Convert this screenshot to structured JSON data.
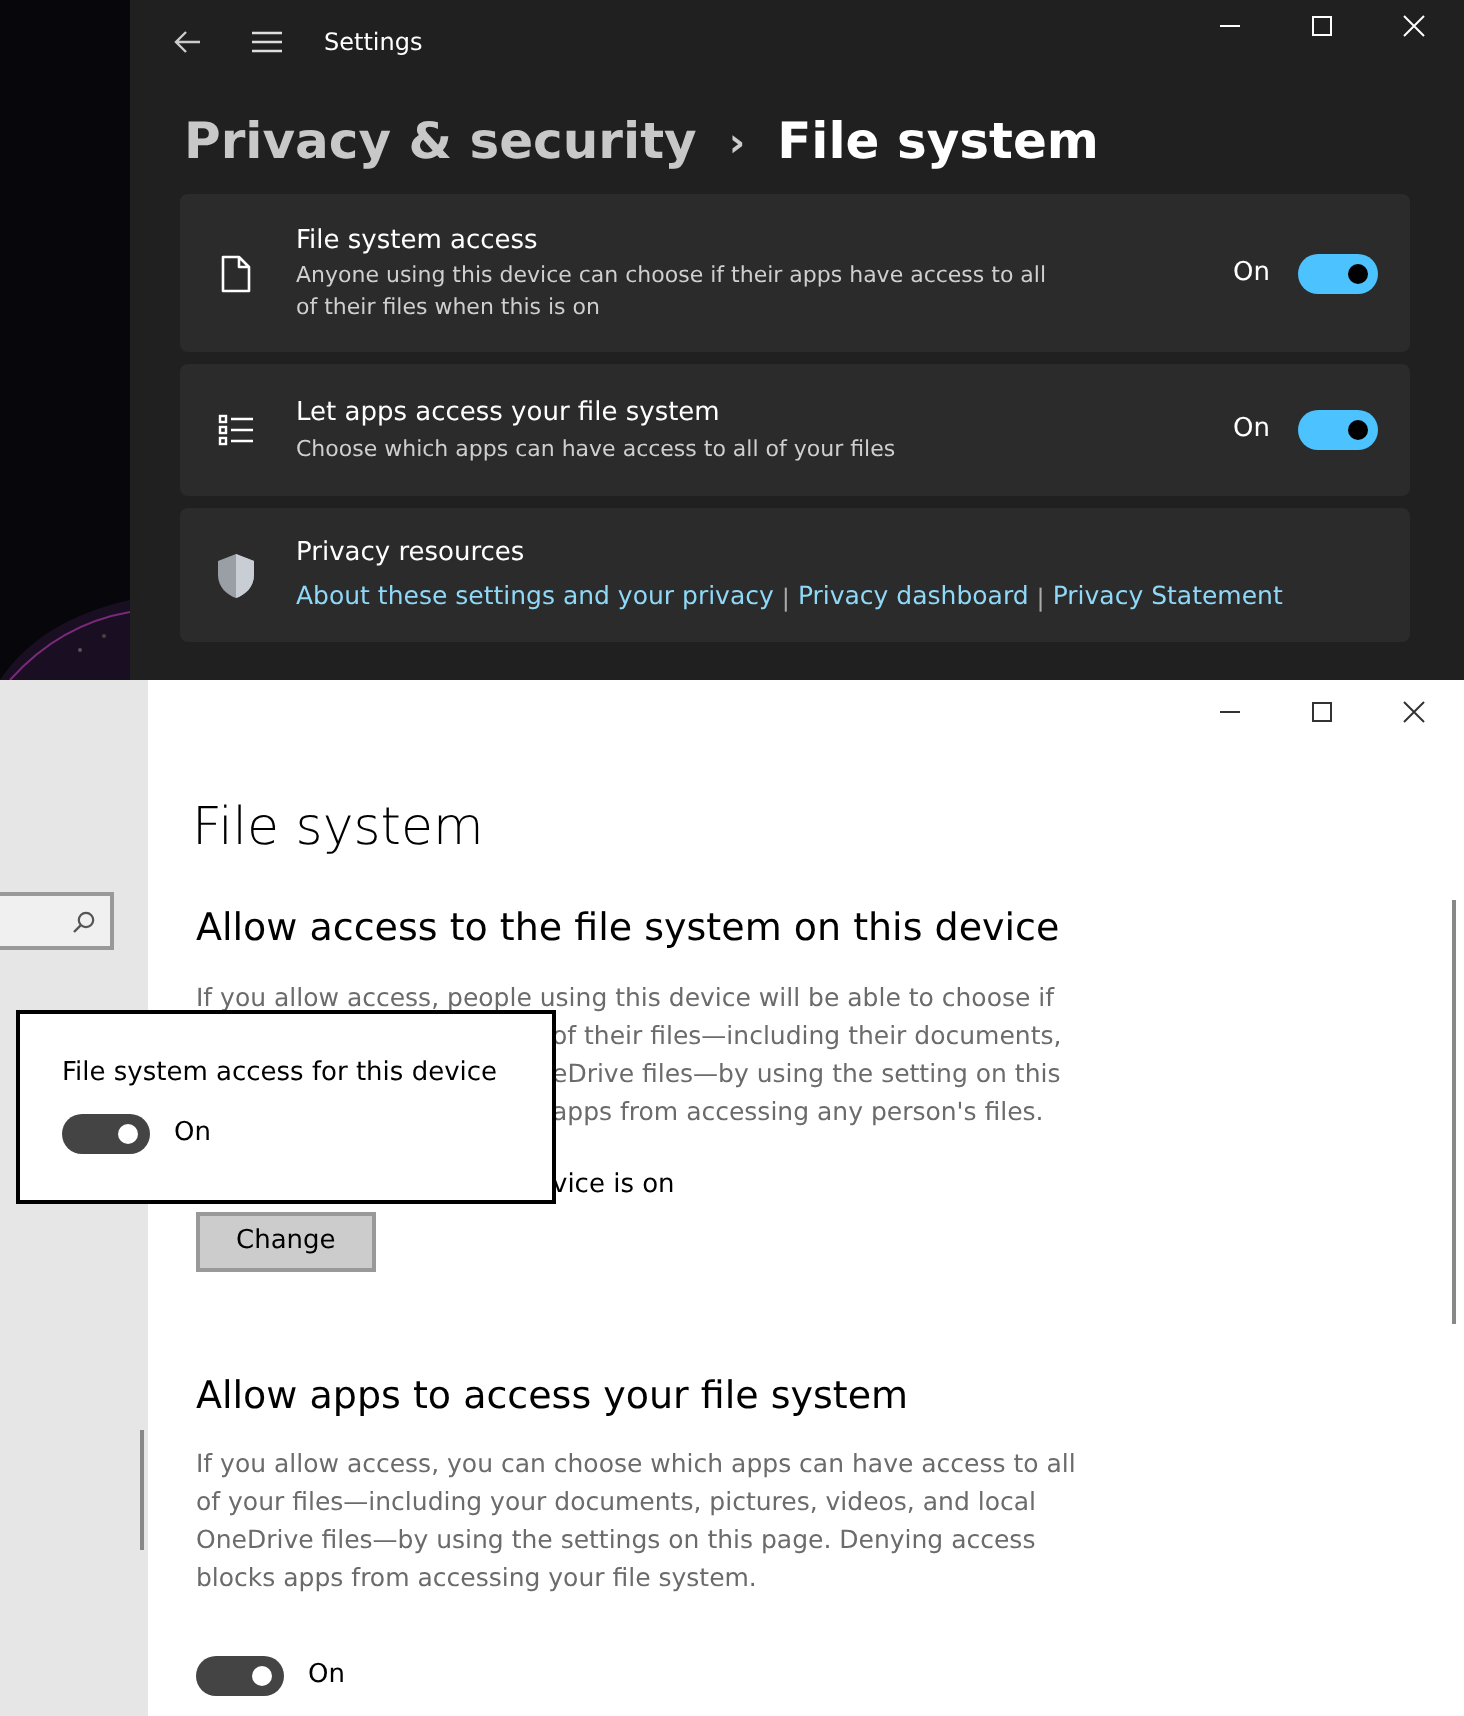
{
  "dark_window": {
    "title": "Settings",
    "breadcrumb": {
      "parent": "Privacy & security",
      "separator": "›",
      "current": "File system"
    },
    "cards": [
      {
        "kind": "toggle",
        "title": "File system access",
        "description": "Anyone using this device can choose if their apps have access to all of their files when this is on",
        "state_label": "On",
        "on": true
      },
      {
        "kind": "toggle",
        "title": "Let apps access your file system",
        "description": "Choose which apps can have access to all of your files",
        "state_label": "On",
        "on": true
      },
      {
        "kind": "links",
        "title": "Privacy resources",
        "links": [
          "About these settings and your privacy",
          "Privacy dashboard",
          "Privacy Statement"
        ],
        "separators": [
          "|",
          "|"
        ]
      }
    ]
  },
  "light_window": {
    "page_title": "File system",
    "sections": [
      {
        "kind": "change",
        "heading": "Allow access to the file system on this device",
        "first_line": "If you allow access, people using this device will be able to choose if",
        "covered_lines": [
          "of their files—including their documents,",
          "eDrive files—by using the setting on this",
          "apps from accessing any person's files."
        ],
        "status": "vice is on",
        "button": "Change"
      },
      {
        "kind": "toggle",
        "heading": "Allow apps to access your file system",
        "paragraph": "If you allow access, you can choose which apps can have access to all of your files—including your documents, pictures, videos, and local OneDrive files—by using the settings on this page. Denying access blocks apps from accessing your file system.",
        "state_label": "On",
        "on": true
      }
    ]
  },
  "popup": {
    "title": "File system access for this device",
    "state_label": "On",
    "on": true
  }
}
